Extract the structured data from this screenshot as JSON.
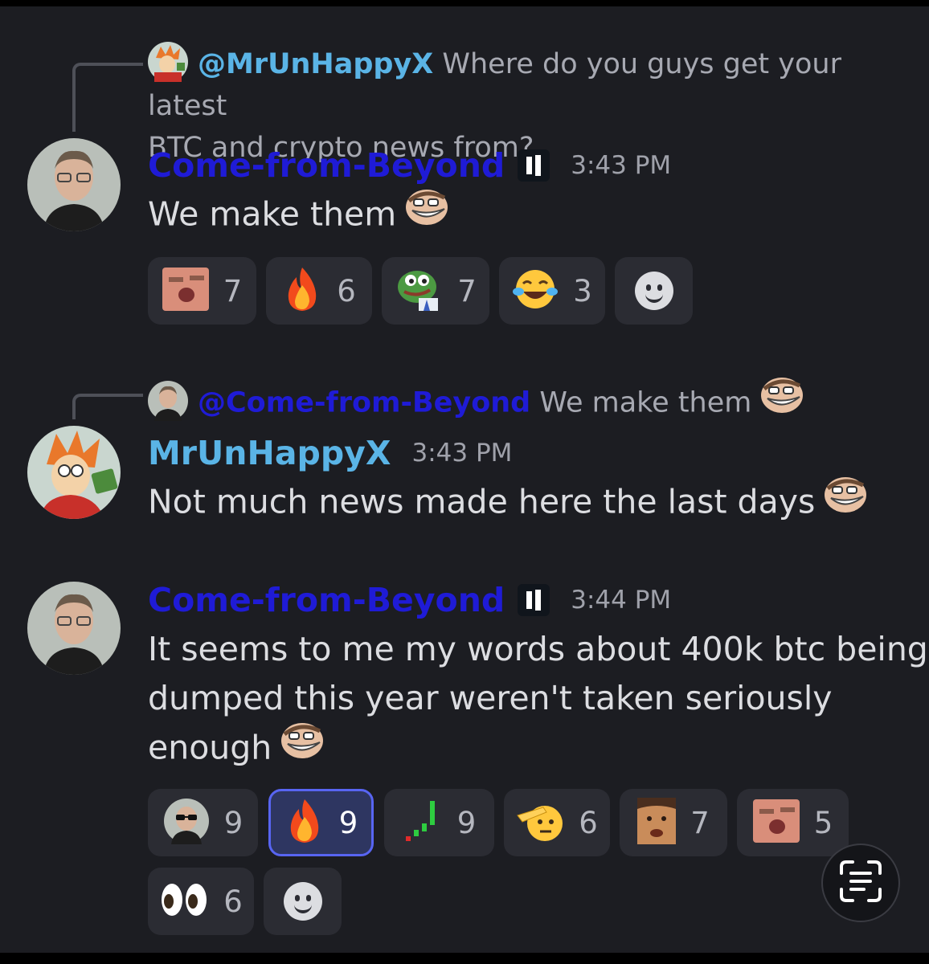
{
  "messages": [
    {
      "reply": {
        "mention": "@MrUnHappyX",
        "text": "Where do you guys get your latest",
        "text2": "BTC and crypto news from?"
      },
      "author": "Come-from-Beyond",
      "author_color": "#1f1bd6",
      "time": "3:43 PM",
      "text": "We make them",
      "reactions": [
        {
          "icon": "kiss-face-emote",
          "count": "7"
        },
        {
          "icon": "fire-emoji",
          "count": "6"
        },
        {
          "icon": "pepe-frog-emote",
          "count": "7"
        },
        {
          "icon": "tears-of-joy-emoji",
          "count": "3"
        }
      ]
    },
    {
      "reply": {
        "mention": "@Come-from-Beyond",
        "text": "We make them"
      },
      "author": "MrUnHappyX",
      "author_color": "#5ab4e6",
      "time": "3:43 PM",
      "text": "Not much news made here the last days"
    },
    {
      "author": "Come-from-Beyond",
      "author_color": "#1f1bd6",
      "time": "3:44 PM",
      "text_lines": [
        "It seems to me my words about 400k btc being",
        "dumped this year weren't taken seriously",
        "enough"
      ],
      "reactions": [
        {
          "icon": "sunglasses-guy-emote",
          "count": "9"
        },
        {
          "icon": "fire-emoji",
          "count": "9",
          "active": true
        },
        {
          "icon": "chart-up-emote",
          "count": "9"
        },
        {
          "icon": "saluting-face-emoji",
          "count": "6"
        },
        {
          "icon": "man-face-emote",
          "count": "7"
        },
        {
          "icon": "kiss-face-emote",
          "count": "5"
        },
        {
          "icon": "eyes-emoji",
          "count": "6"
        }
      ]
    }
  ],
  "colors": {
    "background": "#1c1d22",
    "reaction_bg": "#2b2c33",
    "reaction_active": "#5865f2"
  }
}
